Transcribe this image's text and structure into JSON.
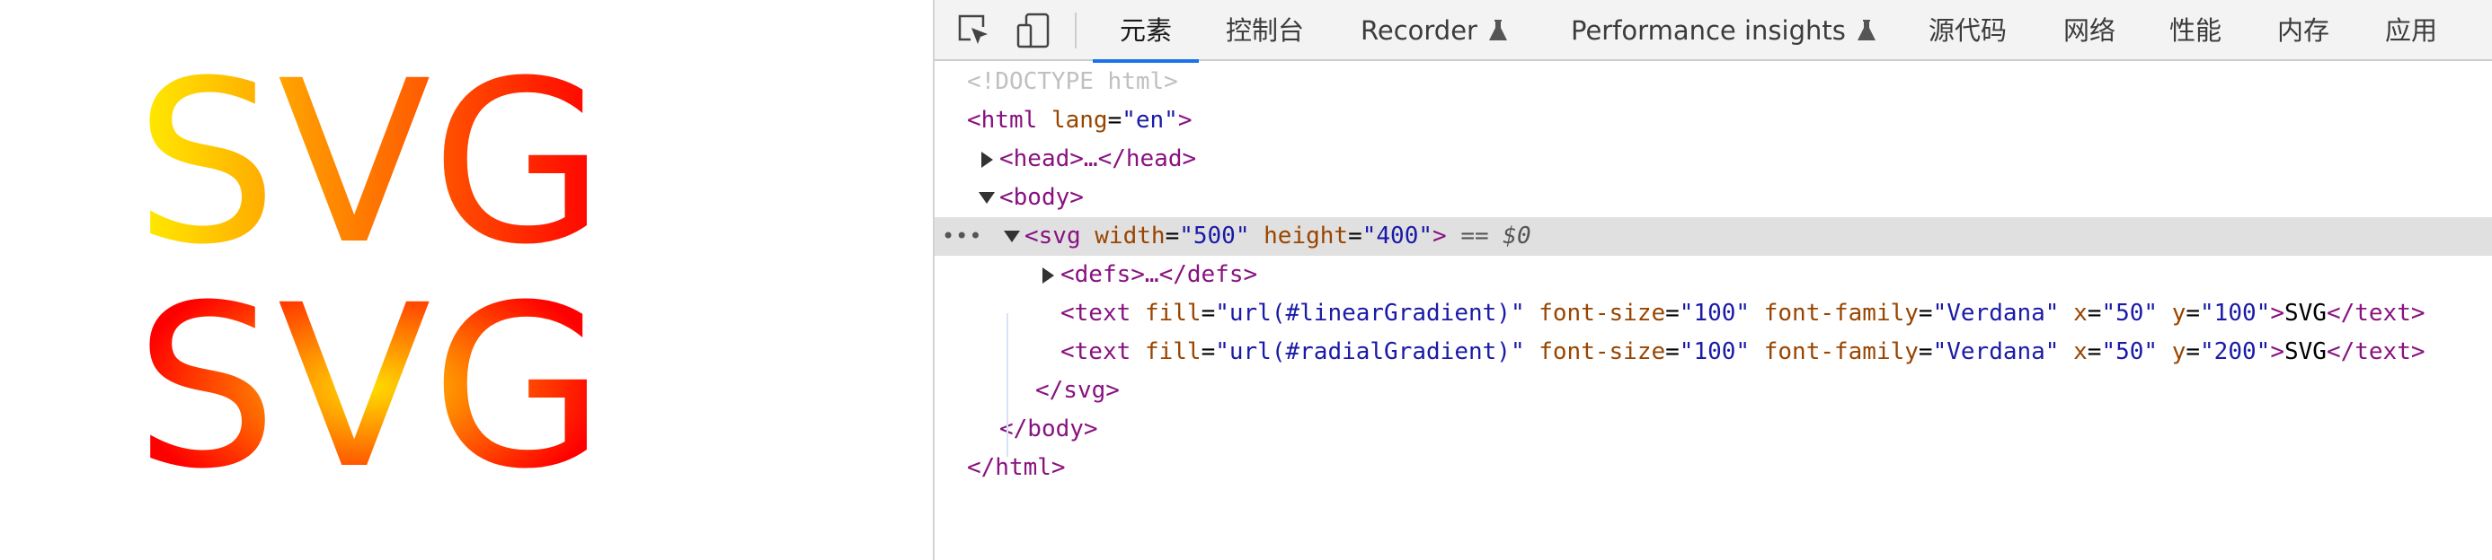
{
  "preview": {
    "lines": [
      "SVG",
      "SVG"
    ],
    "linear_gradient_colors": [
      "#ffee00",
      "#ff0000"
    ],
    "radial_gradient_colors": [
      "#ffdd00",
      "#ff0000"
    ]
  },
  "devtools": {
    "toolbar": {
      "inspect_icon": "select-element-icon",
      "device_icon": "device-toggle-icon"
    },
    "tabs": [
      {
        "label": "元素",
        "active": true
      },
      {
        "label": "控制台"
      },
      {
        "label": "Recorder",
        "experimental": true
      },
      {
        "label": "Performance insights",
        "experimental": true
      },
      {
        "label": "源代码"
      },
      {
        "label": "网络"
      },
      {
        "label": "性能"
      },
      {
        "label": "内存"
      },
      {
        "label": "应用"
      }
    ],
    "accent": "#1a73e8",
    "tree": {
      "doctype": "<!DOCTYPE html>",
      "html_open": "<html",
      "html_lang_attr": "lang",
      "html_lang_val": "\"en\"",
      "gt": ">",
      "head_collapsed": "<head>…</head>",
      "body_open": "<body>",
      "svg_open": "<svg",
      "svg_width_attr": "width",
      "svg_width_val": "\"500\"",
      "svg_height_attr": "height",
      "svg_height_val": "\"400\"",
      "selected_marker": "== $0",
      "defs_collapsed": "<defs>…</defs>",
      "text_open": "<text",
      "fill_attr": "fill",
      "fill1_val": "\"url(#linearGradient)\"",
      "fill2_val": "\"url(#radialGradient)\"",
      "fontsize_attr": "font-size",
      "fontsize_val": "\"100\"",
      "fontfamily_attr": "font-family",
      "fontfamily_val": "\"Verdana\"",
      "x_attr": "x",
      "x_val": "\"50\"",
      "y_attr": "y",
      "y1_val": "\"100\"",
      "y2_val": "\"200\"",
      "text_content": "SVG",
      "text_close": "</text>",
      "svg_close": "</svg>",
      "body_close": "</body>",
      "html_close": "</html>",
      "eq": "="
    }
  }
}
